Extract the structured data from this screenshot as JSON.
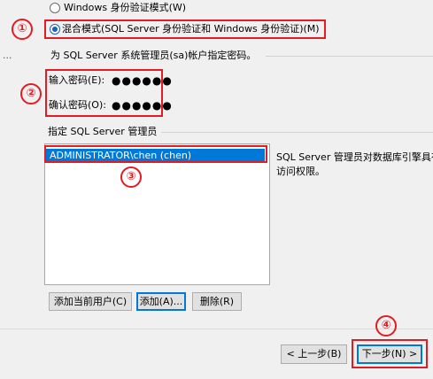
{
  "left_ellipsis": "...",
  "auth": {
    "windows_mode": "Windows 身份验证模式(W)",
    "mixed_mode": "混合模式(SQL Server 身份验证和 Windows 身份验证)(M)"
  },
  "sa_group_label": "为 SQL Server 系统管理员(sa)帐户指定密码。",
  "password": {
    "enter_label": "输入密码(E):",
    "enter_value": "●●●●●●",
    "confirm_label": "确认密码(O):",
    "confirm_value": "●●●●●●"
  },
  "admin_group_label": "指定 SQL Server 管理员",
  "admin_list": [
    "ADMINISTRATOR\\chen (chen)"
  ],
  "description": {
    "line1": "SQL Server 管理员对数据库引擎具有",
    "line2": "访问权限。"
  },
  "buttons": {
    "add_current_user": "添加当前用户(C)",
    "add": "添加(A)...",
    "remove": "删除(R)"
  },
  "nav": {
    "back": "< 上一步(B)",
    "next": "下一步(N) >"
  },
  "annotations": [
    "①",
    "②",
    "③",
    "④"
  ],
  "colors": {
    "highlight": "#e31b23",
    "selection": "#0078d7"
  }
}
